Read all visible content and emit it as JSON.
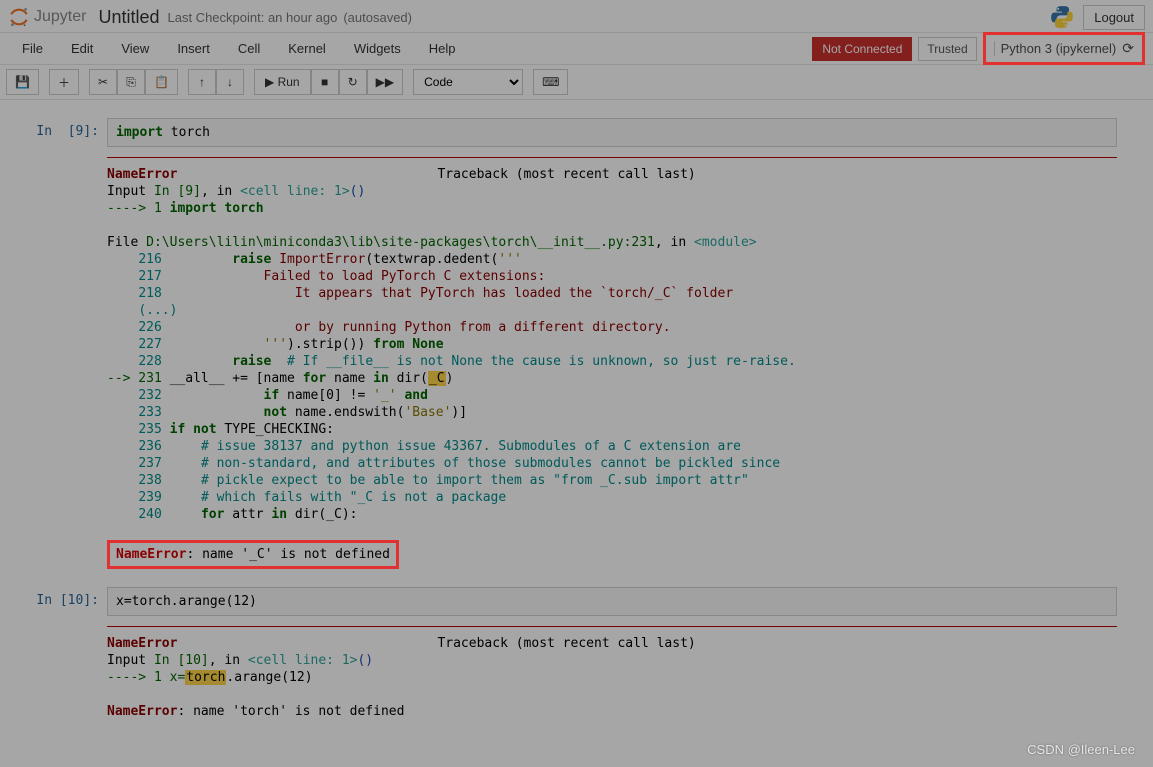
{
  "header": {
    "logo_text": "Jupyter",
    "title": "Untitled",
    "checkpoint": "Last Checkpoint: an hour ago",
    "autosaved": "(autosaved)",
    "logout": "Logout"
  },
  "menubar": {
    "items": [
      "File",
      "Edit",
      "View",
      "Insert",
      "Cell",
      "Kernel",
      "Widgets",
      "Help"
    ],
    "not_connected": "Not Connected",
    "trusted": "Trusted",
    "kernel": "Python 3 (ipykernel)"
  },
  "toolbar": {
    "run": "Run",
    "cell_type": "Code"
  },
  "cells": [
    {
      "prompt_label": "In",
      "prompt_num": "[9]:",
      "code_kw": "import",
      "code_rest": " torch",
      "error": {
        "name": "NameError",
        "traceback_header": "Traceback (most recent call last)",
        "input_line_prefix": "Input ",
        "input_in": "In [9]",
        "input_in_suffix": ", in ",
        "cell_ref": "<cell line: 1>",
        "cell_suffix": "()",
        "arrow1": "----> 1 ",
        "arrow1_kw": "import",
        "arrow1_rest": " torch",
        "file_prefix": "File ",
        "file_path": "D:\\Users\\lilin\\miniconda3\\lib\\site-packages\\torch\\__init__.py:231",
        "file_suffix": ", in ",
        "file_mod": "<module>",
        "lines": [
          {
            "num": "216",
            "indent": "        ",
            "code": "raise ImportError(textwrap.dedent('''",
            "kw": "raise",
            "rest": " ",
            "cls": "ImportError",
            "after": "(textwrap.dedent('''"
          },
          {
            "num": "217",
            "text": "            Failed to load PyTorch C extensions:"
          },
          {
            "num": "218",
            "text": "                It appears that PyTorch has loaded the `torch/_C` folder"
          },
          {
            "ellipsis": "    (...)"
          },
          {
            "num": "226",
            "text": "                or by running Python from a different directory."
          },
          {
            "num": "227",
            "indent": "            ",
            "str": "'''",
            "after": ").strip()) ",
            "kw": "from",
            "none": " None"
          },
          {
            "num": "228",
            "indent": "        ",
            "kw": "raise",
            "comment": "  # If __file__ is not None the cause is unknown, so just re-raise."
          },
          {
            "arrow": "--> 231 ",
            "code_pre": "__all__ += [name ",
            "kw1": "for",
            "mid": " name ",
            "kw2": "in",
            "after": " dir(",
            "hl": "_C",
            "close": ")"
          },
          {
            "num": "232",
            "indent": "            ",
            "kw": "if",
            "after": " name[0] != ",
            "str": "'_'",
            "kw2": " and"
          },
          {
            "num": "233",
            "indent": "            ",
            "kw": "not",
            "after": " name.endswith(",
            "str": "'Base'",
            "close": ")]"
          },
          {
            "num": "235",
            "indent": "    ",
            "kw": "if not",
            "after": " TYPE_CHECKING:"
          },
          {
            "num": "236",
            "comment": "        # issue 38137 and python issue 43367. Submodules of a C extension are"
          },
          {
            "num": "237",
            "comment": "        # non-standard, and attributes of those submodules cannot be pickled since"
          },
          {
            "num": "238",
            "comment": "        # pickle expect to be able to import them as \"from _C.sub import attr\""
          },
          {
            "num": "239",
            "comment": "        # which fails with \"_C is not a package"
          },
          {
            "num": "240",
            "indent": "        ",
            "kw": "for",
            "mid": " attr ",
            "kw2": "in",
            "after": " dir(_C):"
          }
        ],
        "final_name": "NameError",
        "final_msg": ": name '_C' is not defined"
      }
    },
    {
      "prompt_label": "In",
      "prompt_num": "[10]:",
      "code": "x=torch.arange(12)",
      "error": {
        "name": "NameError",
        "traceback_header": "Traceback (most recent call last)",
        "input_in": "In [10]",
        "cell_ref": "<cell line: 1>",
        "arrow_line_pre": "----> 1 x=",
        "arrow_hl": "torch",
        "arrow_line_post": ".arange(12)",
        "final_name": "NameError",
        "final_msg": ": name 'torch' is not defined"
      }
    }
  ],
  "watermark": "CSDN @Ileen-Lee"
}
